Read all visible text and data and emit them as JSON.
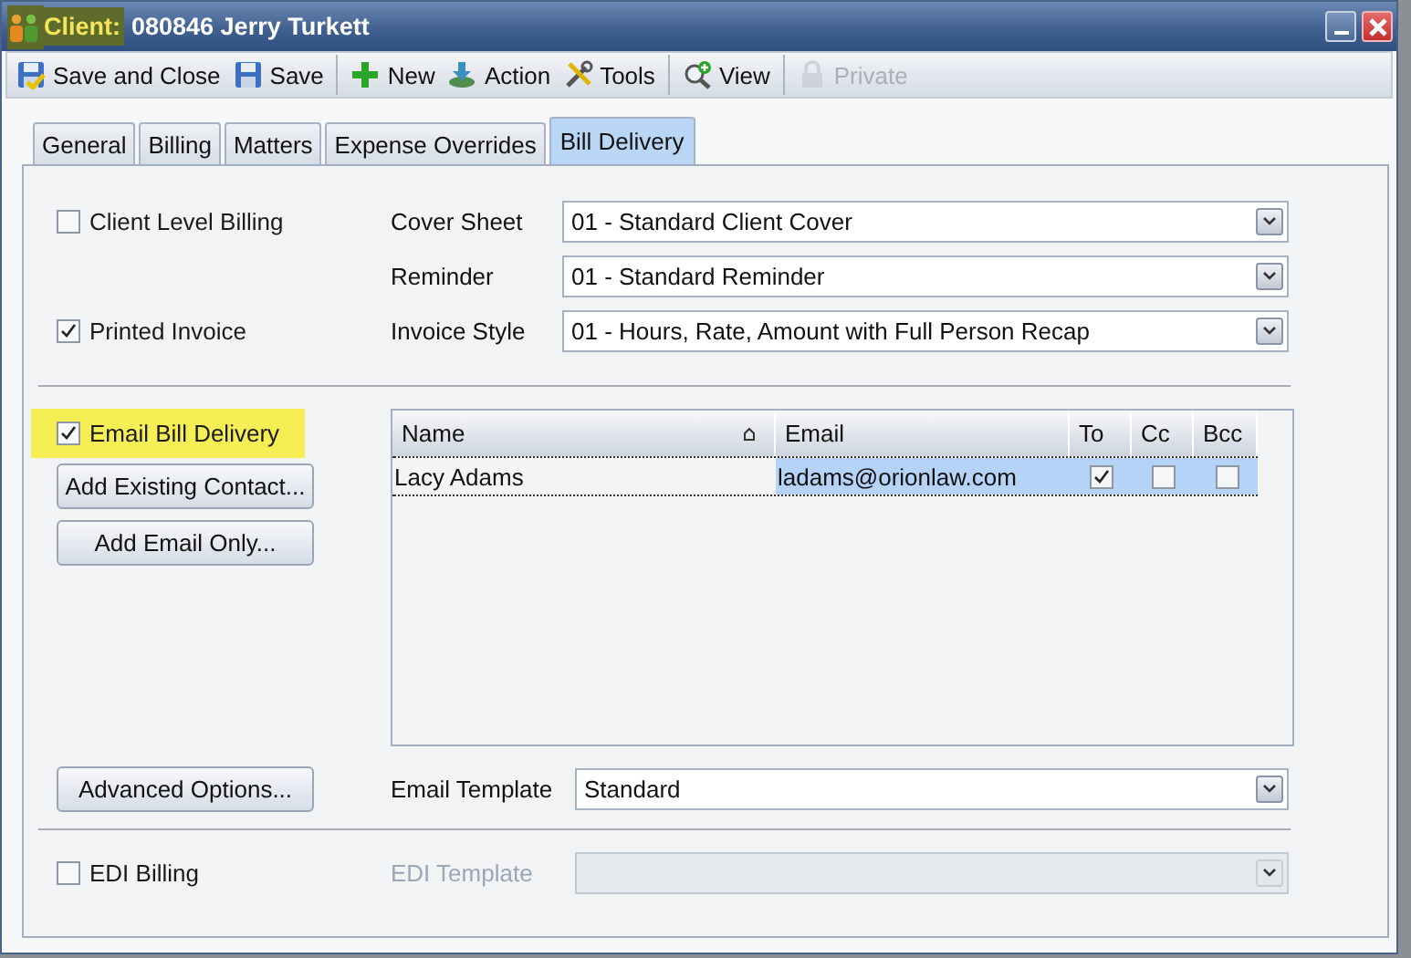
{
  "window": {
    "title_label": "Client:",
    "title_value": "080846 Jerry Turkett"
  },
  "toolbar": {
    "groups": [
      [
        {
          "kind": "save-close",
          "label": "Save and Close",
          "disabled": false
        },
        {
          "kind": "save",
          "label": "Save",
          "disabled": false
        }
      ],
      [
        {
          "kind": "new",
          "label": "New",
          "disabled": false
        },
        {
          "kind": "action",
          "label": "Action",
          "disabled": false
        },
        {
          "kind": "tools",
          "label": "Tools",
          "disabled": false
        }
      ],
      [
        {
          "kind": "view",
          "label": "View",
          "disabled": false
        }
      ],
      [
        {
          "kind": "lock",
          "label": "Private",
          "disabled": true
        }
      ]
    ]
  },
  "tabs": [
    {
      "label": "General",
      "selected": false
    },
    {
      "label": "Billing",
      "selected": false
    },
    {
      "label": "Matters",
      "selected": false
    },
    {
      "label": "Expense Overrides",
      "selected": false
    },
    {
      "label": "Bill Delivery",
      "selected": true
    }
  ],
  "billing": {
    "client_level_billing": {
      "label": "Client Level Billing",
      "checked": false
    },
    "printed_invoice": {
      "label": "Printed Invoice",
      "checked": true
    },
    "cover_sheet": {
      "label": "Cover Sheet",
      "value": "01 - Standard Client Cover"
    },
    "reminder": {
      "label": "Reminder",
      "value": "01 - Standard Reminder"
    },
    "invoice_style": {
      "label": "Invoice Style",
      "value": "01 - Hours, Rate, Amount with Full Person Recap"
    }
  },
  "email": {
    "email_bill_delivery": {
      "label": "Email Bill Delivery",
      "checked": true,
      "highlighted": true
    },
    "buttons": [
      "Add Existing Contact...",
      "Add Email Only..."
    ],
    "grid": {
      "columns": [
        {
          "label": "Name",
          "sorted": true
        },
        {
          "label": "Email",
          "sorted": false
        },
        {
          "label": "To",
          "sorted": false
        },
        {
          "label": "Cc",
          "sorted": false
        },
        {
          "label": "Bcc",
          "sorted": false
        }
      ],
      "rows": [
        {
          "name": "Lacy Adams",
          "email": "ladams@orionlaw.com",
          "to": true,
          "cc": false,
          "bcc": false,
          "selected": true
        }
      ]
    },
    "advanced_button": "Advanced Options...",
    "email_template": {
      "label": "Email Template",
      "value": "Standard"
    }
  },
  "edi": {
    "edi_billing": {
      "label": "EDI Billing",
      "checked": false
    },
    "edi_template": {
      "label": "EDI Template",
      "disabled": true
    }
  }
}
